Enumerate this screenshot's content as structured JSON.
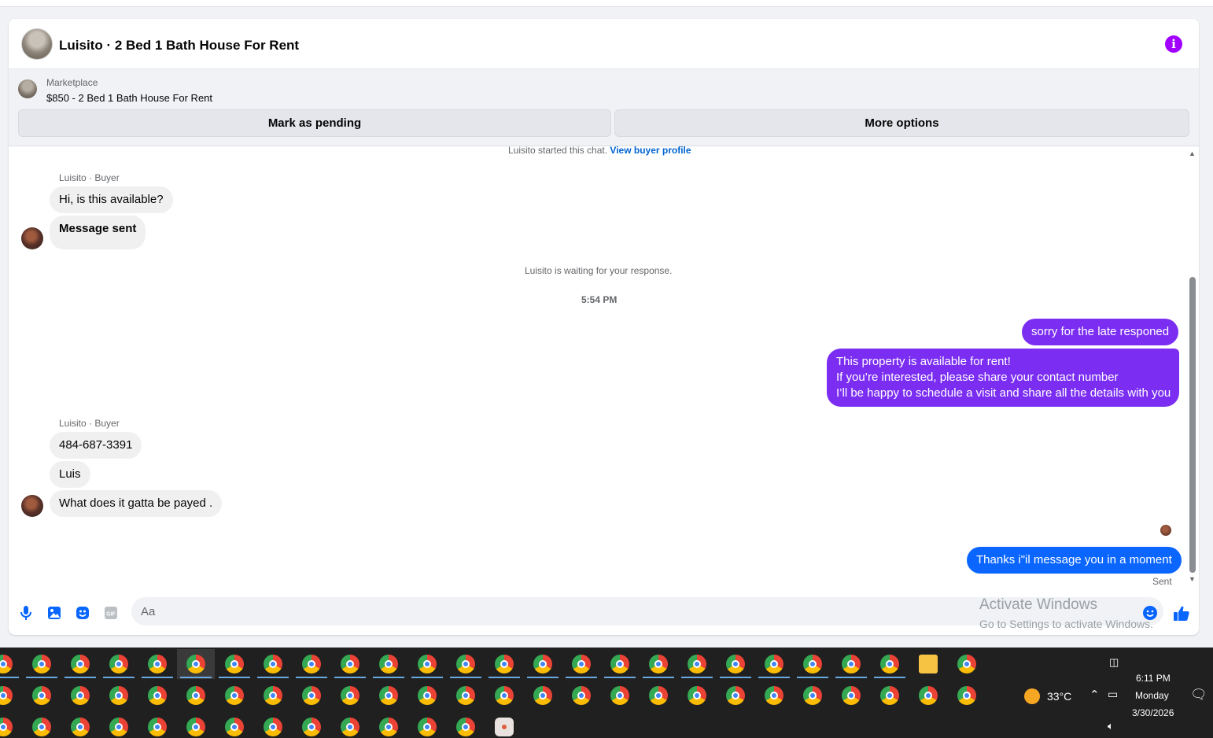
{
  "conversation": {
    "title": "Luisito · 2 Bed 1 Bath House For Rent",
    "info_icon": "info-icon",
    "marketplace_label": "Marketplace",
    "listing": "$850 - 2 Bed 1 Bath House For Rent",
    "mark_pending_label": "Mark as pending",
    "more_options_label": "More options"
  },
  "chat": {
    "started_text": "Luisito started this chat.",
    "view_profile_label": "View buyer profile",
    "sender_label_1": "Luisito · Buyer",
    "sender_label_2": "Luisito · Buyer",
    "waiting_text": "Luisito is waiting for your response.",
    "time_label": "5:54 PM",
    "msg_in_1": "Hi, is this available?",
    "msg_in_2": "Message sent",
    "msg_out_1": "sorry for the late responed",
    "msg_out_2_line1": "This property is available for rent!",
    "msg_out_2_line2": "If you’re interested, please share your contact number",
    "msg_out_2_line3": "I’ll be happy to schedule a visit and share all the details with you",
    "msg_in_3": "484-687-3391",
    "msg_in_4": "Luis",
    "msg_in_5": "What does it gatta be payed .",
    "msg_out_3": "Thanks i\"il message you in a moment",
    "sent_status": "Sent"
  },
  "composer": {
    "placeholder": "Aa",
    "gif_label": "GIF"
  },
  "watermark": {
    "line1": "Activate Windows",
    "line2": "Go to Settings to activate Windows."
  },
  "taskbar": {
    "temperature": "33°C",
    "time": "6:11 PM",
    "day": "Monday",
    "date": "3/30/2026"
  },
  "colors": {
    "outgoing_bubble": "#7b2ef2",
    "last_outgoing_bubble": "#0a66ff",
    "accent": "#0866ff"
  }
}
